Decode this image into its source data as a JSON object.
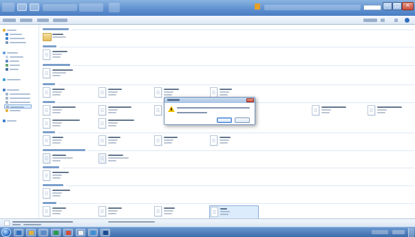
{
  "window": {
    "title": ""
  },
  "command_bar": {
    "organize": "",
    "share_with": "",
    "burn": "",
    "new_folder": "",
    "search_placeholder": ""
  },
  "nav": {
    "items": [
      {
        "label": "",
        "icon": "star-icon"
      },
      {
        "label": "",
        "icon": "desktop-icon"
      },
      {
        "label": "",
        "icon": "download-icon"
      },
      {
        "label": "",
        "icon": "places-icon"
      },
      {
        "label": "",
        "icon": "libraries-icon"
      },
      {
        "label": "",
        "icon": "documents-icon"
      },
      {
        "label": "",
        "icon": "music-icon"
      },
      {
        "label": "",
        "icon": "pictures-icon"
      },
      {
        "label": "",
        "icon": "videos-icon"
      },
      {
        "label": "",
        "icon": "homegroup-icon"
      },
      {
        "label": "",
        "icon": "computer-icon"
      },
      {
        "label": "",
        "icon": "drive-icon"
      },
      {
        "label": "",
        "icon": "drive-icon"
      },
      {
        "label": "",
        "icon": "drive-icon"
      },
      {
        "label": "",
        "icon": "drive-icon"
      },
      {
        "label": "",
        "icon": "drive-icon"
      },
      {
        "label": "",
        "icon": "network-icon"
      }
    ]
  },
  "groups": [
    {
      "label": ""
    },
    {
      "label": ""
    },
    {
      "label": ""
    },
    {
      "label": ""
    },
    {
      "label": ""
    },
    {
      "label": ""
    },
    {
      "label": ""
    },
    {
      "label": ""
    },
    {
      "label": ""
    },
    {
      "label": ""
    },
    {
      "label": ""
    }
  ],
  "dialog": {
    "title": "",
    "message_line1": "",
    "message_line2": "",
    "yes_label": "",
    "no_label": ""
  },
  "details": {
    "file_name": "",
    "file_type": "",
    "date_modified": "",
    "size": ""
  },
  "colors": {
    "accent": "#1f5ea8",
    "title_bar": "#5d8fcf",
    "taskbar": "#3c6cab",
    "warning": "#f2c200"
  }
}
